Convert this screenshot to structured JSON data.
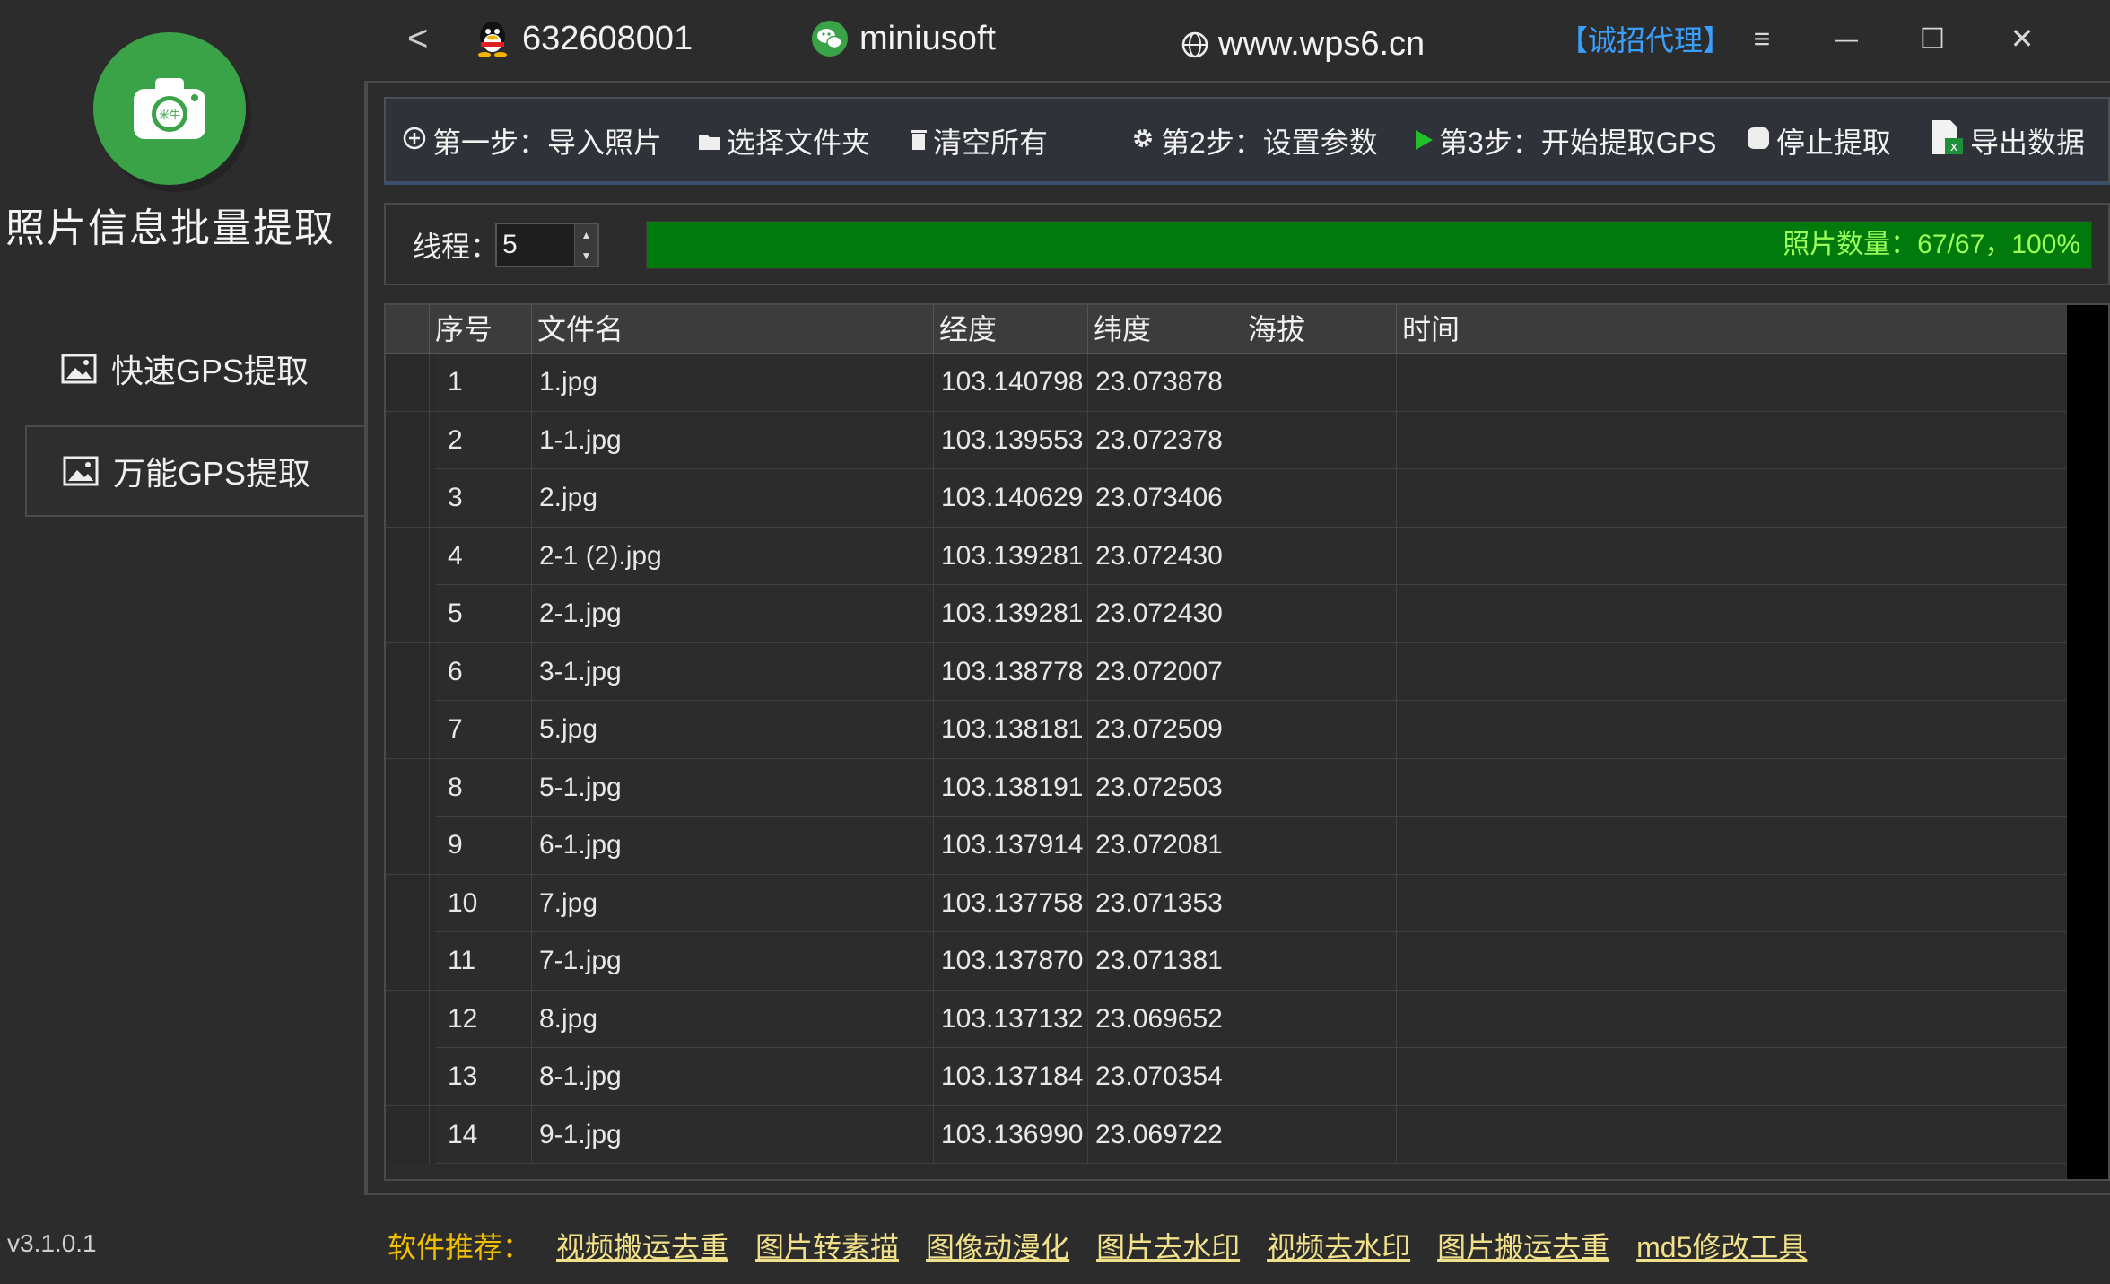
{
  "app": {
    "title": "照片信息批量提取",
    "version": "v3.1.0.1",
    "logo_badge": "米牛"
  },
  "sidebar": {
    "items": [
      {
        "label": "快速GPS提取",
        "icon": "image-icon",
        "active": false
      },
      {
        "label": "万能GPS提取",
        "icon": "image-icon",
        "active": true
      }
    ]
  },
  "titlebar": {
    "back": "<",
    "qq": "632608001",
    "wechat": "miniusoft",
    "site": "www.wps6.cn",
    "agent": "【诚招代理】",
    "menu": "≡",
    "minimize": "—",
    "maximize": "☐",
    "close": "✕"
  },
  "toolbar": {
    "import": "第一步：导入照片",
    "choose_folder": "选择文件夹",
    "clear_all": "清空所有",
    "set_params": "第2步：设置参数",
    "start": "第3步：开始提取GPS",
    "stop": "停止提取",
    "export": "导出数据"
  },
  "threads": {
    "label": "线程：",
    "value": "5"
  },
  "progress": {
    "text": "照片数量：67/67，100%",
    "fraction": 1.0,
    "color": "#007a0c"
  },
  "table": {
    "columns": [
      "序号",
      "文件名",
      "经度",
      "纬度",
      "海拔",
      "时间"
    ],
    "rows": [
      [
        "1",
        "1.jpg",
        "103.140798",
        "23.073878",
        "",
        ""
      ],
      [
        "2",
        "1-1.jpg",
        "103.139553",
        "23.072378",
        "",
        ""
      ],
      [
        "3",
        "2.jpg",
        "103.140629",
        "23.073406",
        "",
        ""
      ],
      [
        "4",
        "2-1 (2).jpg",
        "103.139281",
        "23.072430",
        "",
        ""
      ],
      [
        "5",
        "2-1.jpg",
        "103.139281",
        "23.072430",
        "",
        ""
      ],
      [
        "6",
        "3-1.jpg",
        "103.138778",
        "23.072007",
        "",
        ""
      ],
      [
        "7",
        "5.jpg",
        "103.138181",
        "23.072509",
        "",
        ""
      ],
      [
        "8",
        "5-1.jpg",
        "103.138191",
        "23.072503",
        "",
        ""
      ],
      [
        "9",
        "6-1.jpg",
        "103.137914",
        "23.072081",
        "",
        ""
      ],
      [
        "10",
        "7.jpg",
        "103.137758",
        "23.071353",
        "",
        ""
      ],
      [
        "11",
        "7-1.jpg",
        "103.137870",
        "23.071381",
        "",
        ""
      ],
      [
        "12",
        "8.jpg",
        "103.137132",
        "23.069652",
        "",
        ""
      ],
      [
        "13",
        "8-1.jpg",
        "103.137184",
        "23.070354",
        "",
        ""
      ],
      [
        "14",
        "9-1.jpg",
        "103.136990",
        "23.069722",
        "",
        ""
      ]
    ]
  },
  "footer": {
    "label": "软件推荐：",
    "links": [
      "视频搬运去重",
      "图片转素描",
      "图像动漫化",
      "图片去水印",
      "视频去水印",
      "图片搬运去重",
      "md5修改工具"
    ]
  }
}
